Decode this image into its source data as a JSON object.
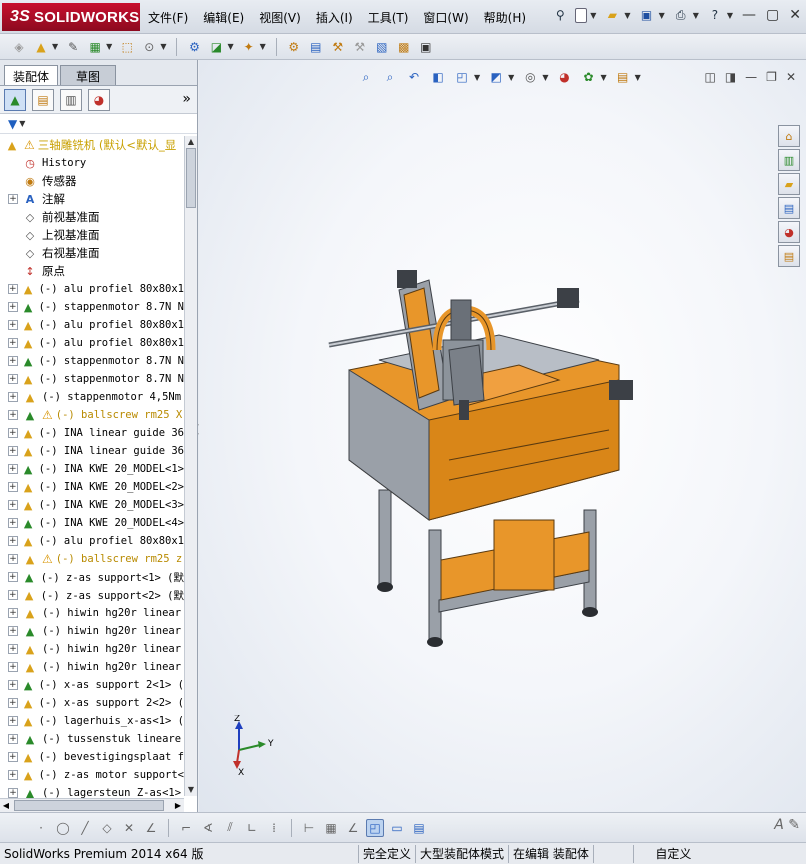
{
  "app": {
    "brand": "SOLIDWORKS",
    "brand_prefix": "3S"
  },
  "menu": [
    "文件(F)",
    "编辑(E)",
    "视图(V)",
    "插入(I)",
    "工具(T)",
    "窗口(W)",
    "帮助(H)"
  ],
  "left_panel": {
    "tabs": [
      "装配体",
      "草图"
    ],
    "more": "»"
  },
  "tree": {
    "root": "三轴雕铣机  (默认<默认_显",
    "fixed_items": [
      "History",
      "传感器",
      "注解",
      "前视基准面",
      "上视基准面",
      "右视基准面",
      "原点"
    ],
    "components": [
      {
        "label": "(-) alu profiel 80x80x1",
        "warn": false
      },
      {
        "label": "(-) stappenmotor 8.7N N",
        "warn": false
      },
      {
        "label": "(-) alu profiel 80x80x1",
        "warn": false
      },
      {
        "label": "(-) alu profiel 80x80x1",
        "warn": false
      },
      {
        "label": "(-) stappenmotor 8.7N N",
        "warn": false
      },
      {
        "label": "(-) stappenmotor 8.7N N",
        "warn": false
      },
      {
        "label": "(-) stappenmotor 4,5Nm",
        "warn": false
      },
      {
        "label": "(-) ballscrew rm25 X",
        "warn": true
      },
      {
        "label": "(-) INA linear guide 36",
        "warn": false
      },
      {
        "label": "(-) INA linear guide 36",
        "warn": false
      },
      {
        "label": "(-) INA KWE 20_MODEL<1>",
        "warn": false
      },
      {
        "label": "(-) INA KWE 20_MODEL<2>",
        "warn": false
      },
      {
        "label": "(-) INA KWE 20_MODEL<3>",
        "warn": false
      },
      {
        "label": "(-) INA KWE 20_MODEL<4>",
        "warn": false
      },
      {
        "label": "(-) alu profiel 80x80x1",
        "warn": false
      },
      {
        "label": "(-) ballscrew rm25 z",
        "warn": true
      },
      {
        "label": "(-) z-as support<1> (默",
        "warn": false
      },
      {
        "label": "(-) z-as support<2> (默",
        "warn": false
      },
      {
        "label": "(-) hiwin hg20r linear",
        "warn": false
      },
      {
        "label": "(-) hiwin hg20r linear",
        "warn": false
      },
      {
        "label": "(-) hiwin hg20r linear",
        "warn": false
      },
      {
        "label": "(-) hiwin hg20r linear",
        "warn": false
      },
      {
        "label": "(-) x-as support 2<1> (",
        "warn": false
      },
      {
        "label": "(-) x-as support 2<2> (",
        "warn": false
      },
      {
        "label": "(-) lagerhuis_x-as<1> (",
        "warn": false
      },
      {
        "label": "(-) tussenstuk lineare",
        "warn": false
      },
      {
        "label": "(-) bevestigingsplaat f",
        "warn": false
      },
      {
        "label": "(-) z-as motor support<",
        "warn": false
      },
      {
        "label": "(-) lagersteun_Z-as<1>",
        "warn": false
      }
    ]
  },
  "triad": {
    "x": "X",
    "y": "Y",
    "z": "Z"
  },
  "statusbar": {
    "product": "SolidWorks Premium 2014 x64 版",
    "constraint": "完全定义",
    "mode": "大型装配体模式",
    "editing": "在编辑 装配体",
    "units": "自定义"
  },
  "colors": {
    "orange": "#e8962a",
    "steel": "#8c939b",
    "dark": "#3c4046"
  }
}
